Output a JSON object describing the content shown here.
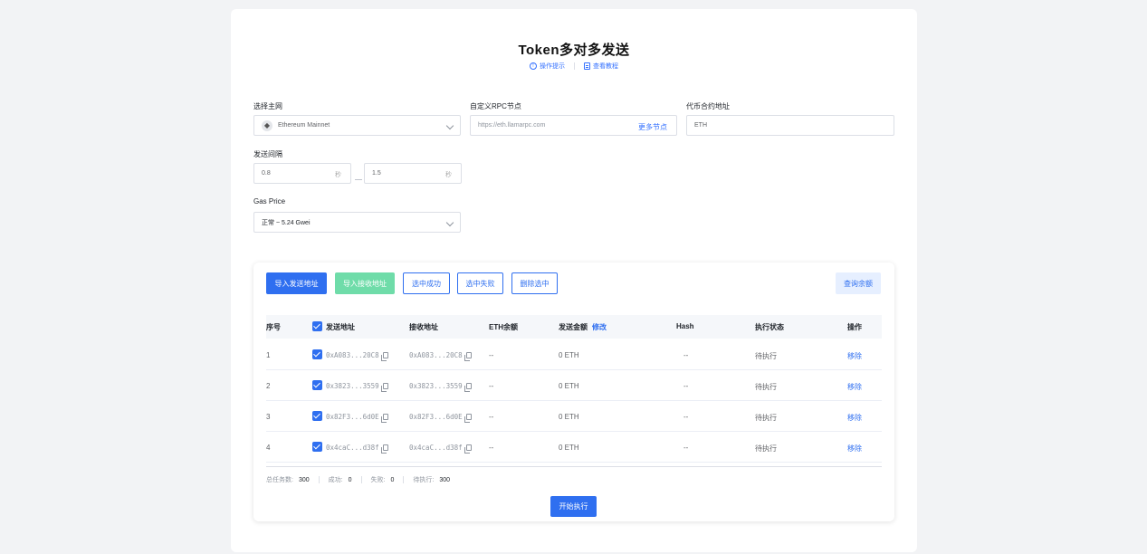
{
  "header": {
    "title": "Token多对多发送",
    "tips_link": "操作提示",
    "tutorial_link": "查看教程",
    "tips_icon": "info-circle-icon",
    "tutorial_icon": "document-icon"
  },
  "form": {
    "network_label": "选择主网",
    "network_value": "Ethereum Mainnet",
    "rpc_label": "自定义RPC节点",
    "rpc_placeholder": "https://eth.llamarpc.com",
    "rpc_more": "更多节点",
    "contract_label": "代币合约地址",
    "contract_value": "ETH",
    "interval_label": "发送间隔",
    "interval_min": "0.8",
    "interval_max": "1.5",
    "interval_unit": "秒",
    "gas_label": "Gas Price",
    "gas_value": "正常 ~ 5.24 Gwei"
  },
  "toolbar": {
    "import_send": "导入发送地址",
    "import_receive": "导入接收地址",
    "select_success": "选中成功",
    "select_failed": "选中失败",
    "delete_selected": "删除选中",
    "check_balance": "查询余额"
  },
  "table": {
    "headers": {
      "index": "序号",
      "send_addr": "发送地址",
      "recv_addr": "接收地址",
      "eth_balance": "ETH余额",
      "amount": "发送金额",
      "amount_edit": "修改",
      "hash": "Hash",
      "status": "执行状态",
      "action": "操作"
    },
    "rows": [
      {
        "index": "1",
        "send": "0xA083...20C8",
        "recv": "0xA083...20C8",
        "balance": "--",
        "amount": "0 ETH",
        "hash": "--",
        "status": "待执行",
        "action": "移除"
      },
      {
        "index": "2",
        "send": "0x3823...3559",
        "recv": "0x3823...3559",
        "balance": "--",
        "amount": "0 ETH",
        "hash": "--",
        "status": "待执行",
        "action": "移除"
      },
      {
        "index": "3",
        "send": "0x82F3...6d0E",
        "recv": "0x82F3...6d0E",
        "balance": "--",
        "amount": "0 ETH",
        "hash": "--",
        "status": "待执行",
        "action": "移除"
      },
      {
        "index": "4",
        "send": "0x4caC...d38f",
        "recv": "0x4caC...d38f",
        "balance": "--",
        "amount": "0 ETH",
        "hash": "--",
        "status": "待执行",
        "action": "移除"
      }
    ]
  },
  "stats": {
    "total_label": "总任务数:",
    "total": "300",
    "success_label": "成功:",
    "success": "0",
    "failed_label": "失败:",
    "failed": "0",
    "pending_label": "待执行:",
    "pending": "300"
  },
  "start_button": "开始执行",
  "colors": {
    "primary": "#2f6ff0",
    "success_button": "#6fdca9",
    "page_background": "#f2f3f5"
  }
}
